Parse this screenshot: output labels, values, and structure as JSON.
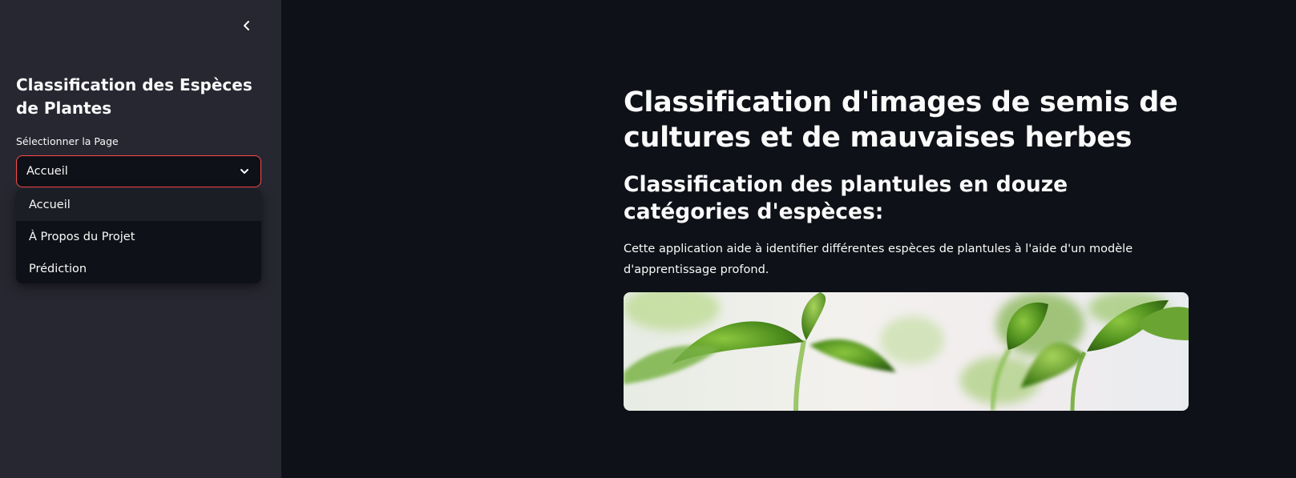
{
  "sidebar": {
    "title": "Classification des Espèces de Plantes",
    "select_label": "Sélectionner la Page",
    "selected_value": "Accueil",
    "options": [
      "Accueil",
      "À Propos du Projet",
      "Prédiction"
    ]
  },
  "main": {
    "title": "Classification d'images de semis de cultures et de mauvaises herbes",
    "subtitle": "Classification des plantules en douze catégories d'espèces:",
    "description": "Cette application aide à identifier différentes espèces de plantules à l'aide d'un modèle d'apprentissage profond."
  },
  "icons": {
    "collapse": "chevron-left-icon",
    "select": "chevron-down-icon"
  },
  "colors": {
    "accent": "#ff4b4b",
    "background": "#0e1117",
    "sidebar": "#262730"
  }
}
